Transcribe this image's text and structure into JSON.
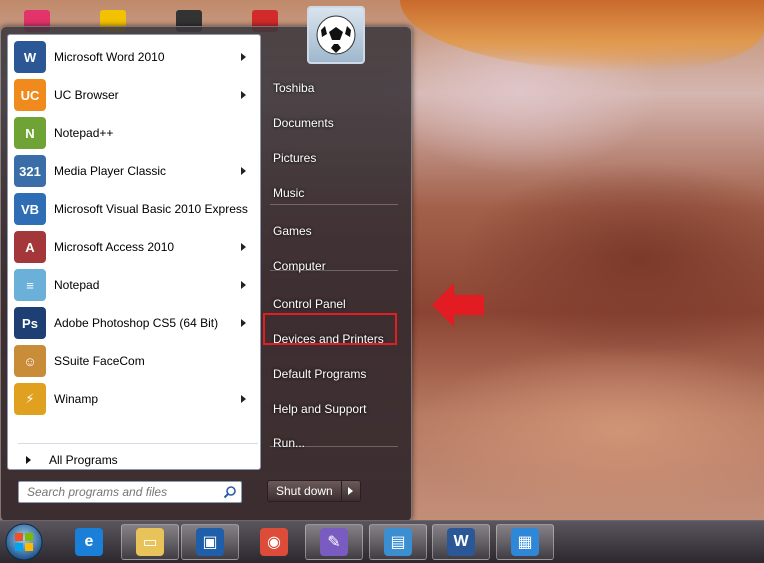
{
  "start_menu": {
    "programs": [
      {
        "label": "Microsoft Word 2010",
        "icon": "word-icon",
        "has_submenu": true,
        "color": "#2b5797",
        "glyph": "W"
      },
      {
        "label": "UC Browser",
        "icon": "uc-browser-icon",
        "has_submenu": true,
        "color": "#f08a1c",
        "glyph": "UC"
      },
      {
        "label": "Notepad++",
        "icon": "notepad-plus-plus-icon",
        "has_submenu": false,
        "color": "#6fa335",
        "glyph": "N"
      },
      {
        "label": "Media Player Classic",
        "icon": "media-player-classic-icon",
        "has_submenu": true,
        "color": "#3a6ea8",
        "glyph": "321"
      },
      {
        "label": "Microsoft Visual Basic 2010 Express",
        "icon": "visual-basic-icon",
        "has_submenu": false,
        "color": "#2f6db5",
        "glyph": "VB"
      },
      {
        "label": "Microsoft Access 2010",
        "icon": "access-icon",
        "has_submenu": true,
        "color": "#a4373a",
        "glyph": "A"
      },
      {
        "label": "Notepad",
        "icon": "notepad-icon",
        "has_submenu": true,
        "color": "#6bb0d8",
        "glyph": "≡"
      },
      {
        "label": "Adobe Photoshop CS5 (64 Bit)",
        "icon": "photoshop-icon",
        "has_submenu": true,
        "color": "#1d3f73",
        "glyph": "Ps"
      },
      {
        "label": "SSuite FaceCom",
        "icon": "facecom-icon",
        "has_submenu": false,
        "color": "#c98d3a",
        "glyph": "☺"
      },
      {
        "label": "Winamp",
        "icon": "winamp-icon",
        "has_submenu": true,
        "color": "#e0a020",
        "glyph": "⚡"
      }
    ],
    "all_programs_label": "All Programs",
    "search_placeholder": "Search programs and files",
    "right_items": [
      {
        "label": "Toshiba"
      },
      {
        "label": "Documents"
      },
      {
        "label": "Pictures"
      },
      {
        "label": "Music"
      },
      {
        "label": "Games"
      },
      {
        "label": "Computer"
      },
      {
        "label": "Control Panel"
      },
      {
        "label": "Devices and Printers"
      },
      {
        "label": "Default Programs"
      },
      {
        "label": "Help and Support"
      },
      {
        "label": "Run..."
      }
    ],
    "shutdown_label": "Shut down"
  },
  "taskbar": {
    "buttons": [
      {
        "icon": "internet-explorer-icon",
        "pinned": false
      },
      {
        "icon": "windows-explorer-icon",
        "pinned": true
      },
      {
        "icon": "virtualbox-icon",
        "pinned": true
      },
      {
        "icon": "chrome-icon",
        "pinned": false
      },
      {
        "icon": "paint-icon",
        "pinned": true
      },
      {
        "icon": "photo-viewer-icon",
        "pinned": true
      },
      {
        "icon": "word-icon",
        "pinned": true
      },
      {
        "icon": "control-panel-icon",
        "pinned": true
      }
    ]
  },
  "colors": {
    "highlight": "#e21e22",
    "arrow": "#e31b23"
  }
}
